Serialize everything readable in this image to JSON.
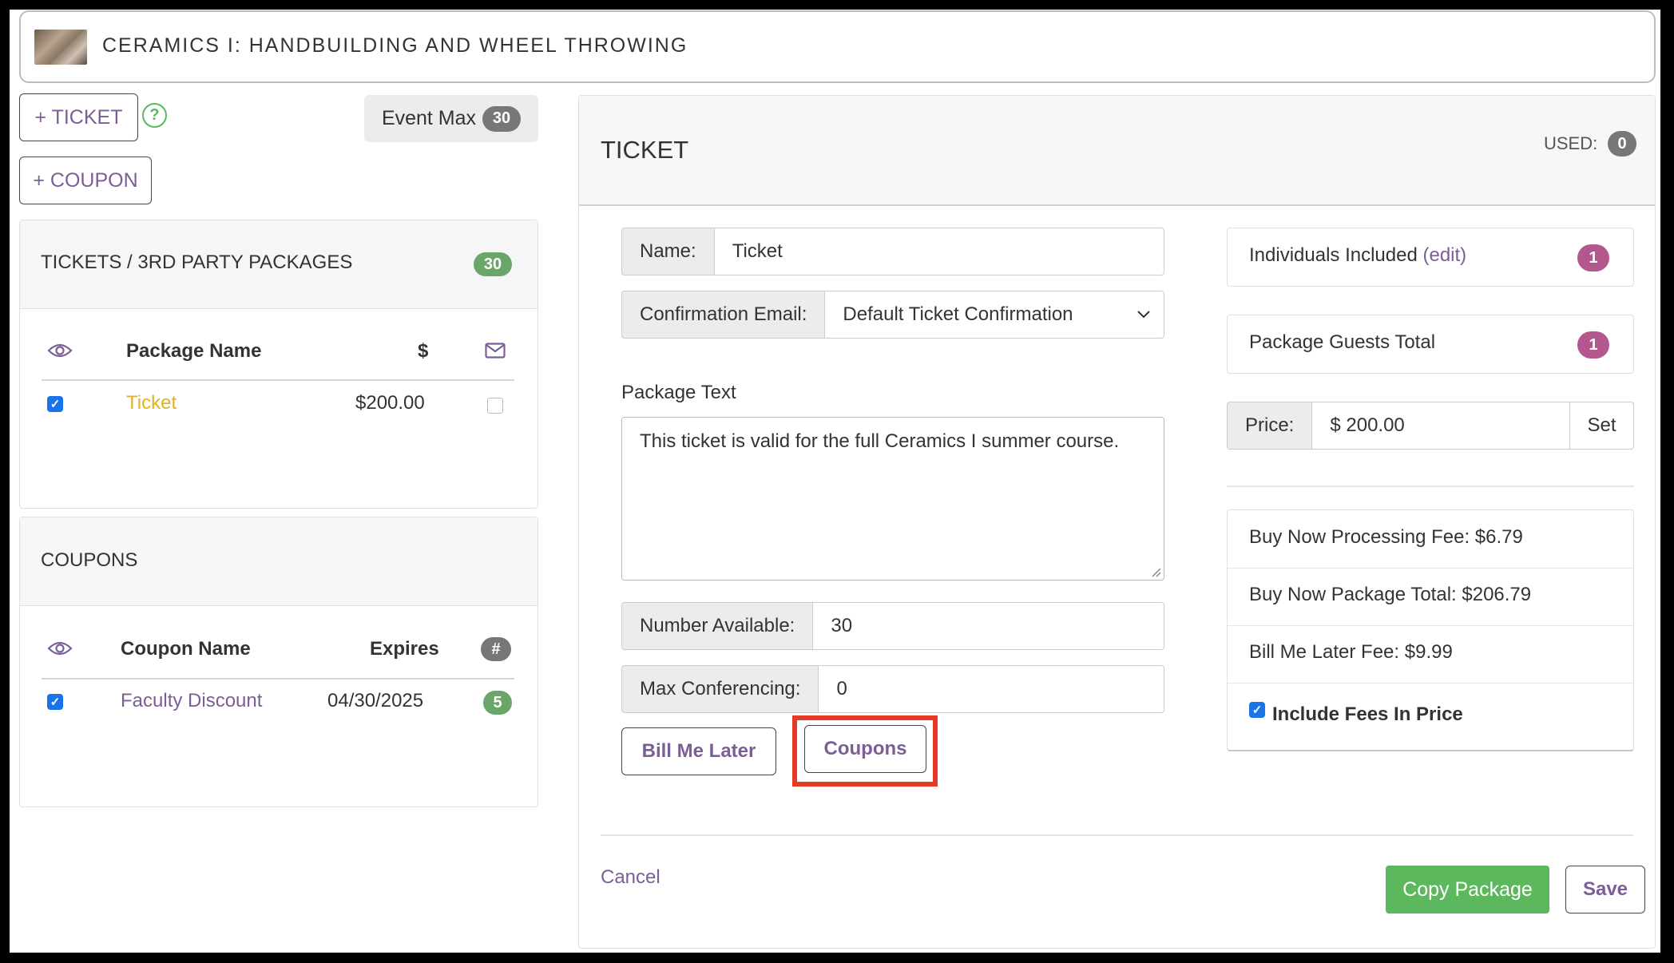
{
  "header": {
    "course_title": "CERAMICS I: HANDBUILDING AND WHEEL THROWING"
  },
  "toolbar": {
    "add_ticket_label": "+ TICKET",
    "add_coupon_label": "+ COUPON",
    "help_glyph": "?",
    "event_max_label": "Event Max",
    "event_max_value": "30"
  },
  "tickets_panel": {
    "title": "TICKETS / 3RD PARTY PACKAGES",
    "count": "30",
    "columns": {
      "package_name": "Package Name",
      "price": "$"
    },
    "rows": [
      {
        "visible": true,
        "name": "Ticket",
        "price": "$200.00",
        "email": false
      }
    ]
  },
  "coupons_panel": {
    "title": "COUPONS",
    "columns": {
      "coupon_name": "Coupon Name",
      "expires": "Expires",
      "count": "#"
    },
    "rows": [
      {
        "visible": true,
        "name": "Faculty Discount",
        "expires": "04/30/2025",
        "count": "5"
      }
    ]
  },
  "editor": {
    "title": "TICKET",
    "used_label": "USED:",
    "used_value": "0",
    "name_label": "Name:",
    "name_value": "Ticket",
    "confirmation_label": "Confirmation Email:",
    "confirmation_value": "Default Ticket Confirmation",
    "package_text_label": "Package Text",
    "package_text_value": "This ticket is valid for the full Ceramics I summer course.",
    "number_available_label": "Number Available:",
    "number_available_value": "30",
    "max_conferencing_label": "Max Conferencing:",
    "max_conferencing_value": "0",
    "bill_me_later_label": "Bill Me Later",
    "coupons_label": "Coupons",
    "cancel_label": "Cancel",
    "copy_package_label": "Copy Package",
    "save_label": "Save"
  },
  "summary": {
    "individuals_label": "Individuals Included",
    "individuals_edit": "(edit)",
    "individuals_value": "1",
    "guests_label": "Package Guests Total",
    "guests_value": "1",
    "price_label": "Price:",
    "price_value": "$ 200.00",
    "set_label": "Set",
    "processing_fee": "Buy Now Processing Fee: $6.79",
    "package_total": "Buy Now Package Total: $206.79",
    "bill_me_later_fee": "Bill Me Later Fee: $9.99",
    "include_fees_label": "Include Fees In Price",
    "include_fees_checked": true
  },
  "colors": {
    "accent_purple": "#7b5e97",
    "ticket_name_gold": "#e0b422",
    "success_green": "#5cb85c",
    "highlight_red": "#e53b26",
    "checkbox_blue": "#1a73e8"
  },
  "icons": {
    "visibility": "eye-icon",
    "email": "envelope-icon",
    "dropdown": "chevron-down-icon",
    "help": "question-circle-icon"
  }
}
